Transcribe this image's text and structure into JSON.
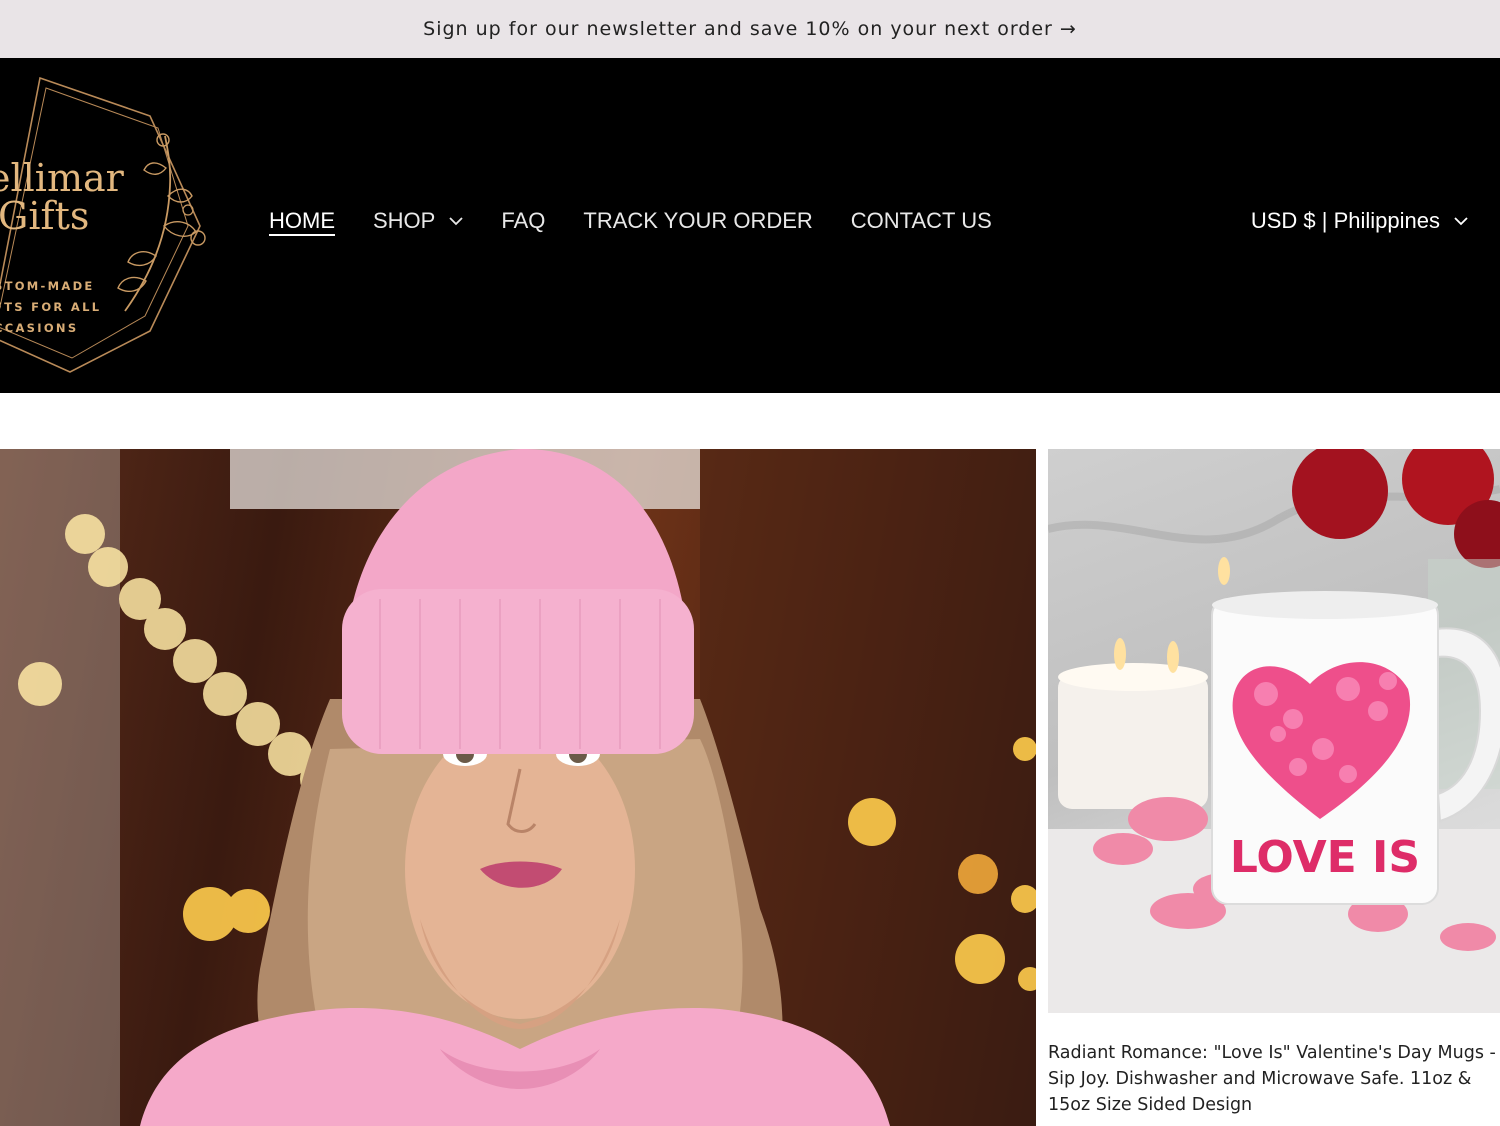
{
  "announcement": {
    "text": "Sign up for our newsletter and save 10% on your next order →"
  },
  "logo": {
    "name_line1": "ellimar",
    "name_line2": "Gifts",
    "tagline_line1": "STOM-MADE",
    "tagline_line2": "FTS FOR ALL",
    "tagline_line3": "CCASIONS"
  },
  "nav": {
    "items": [
      {
        "label": "HOME",
        "active": true
      },
      {
        "label": "SHOP",
        "has_dropdown": true
      },
      {
        "label": "FAQ"
      },
      {
        "label": "TRACK YOUR ORDER"
      },
      {
        "label": "CONTACT US"
      }
    ]
  },
  "currency": {
    "label": "USD $ | Philippines"
  },
  "product": {
    "title": "Radiant Romance: \"Love Is\" Valentine's Day Mugs - Sip Joy. Dishwasher and Microwave Safe. 11oz & 15oz Size Sided Design",
    "mug_text": "LOVE IS"
  },
  "colors": {
    "announcement_bg": "#e9e4e7",
    "header_bg": "#000000",
    "logo_gold": "#e2b77f"
  }
}
